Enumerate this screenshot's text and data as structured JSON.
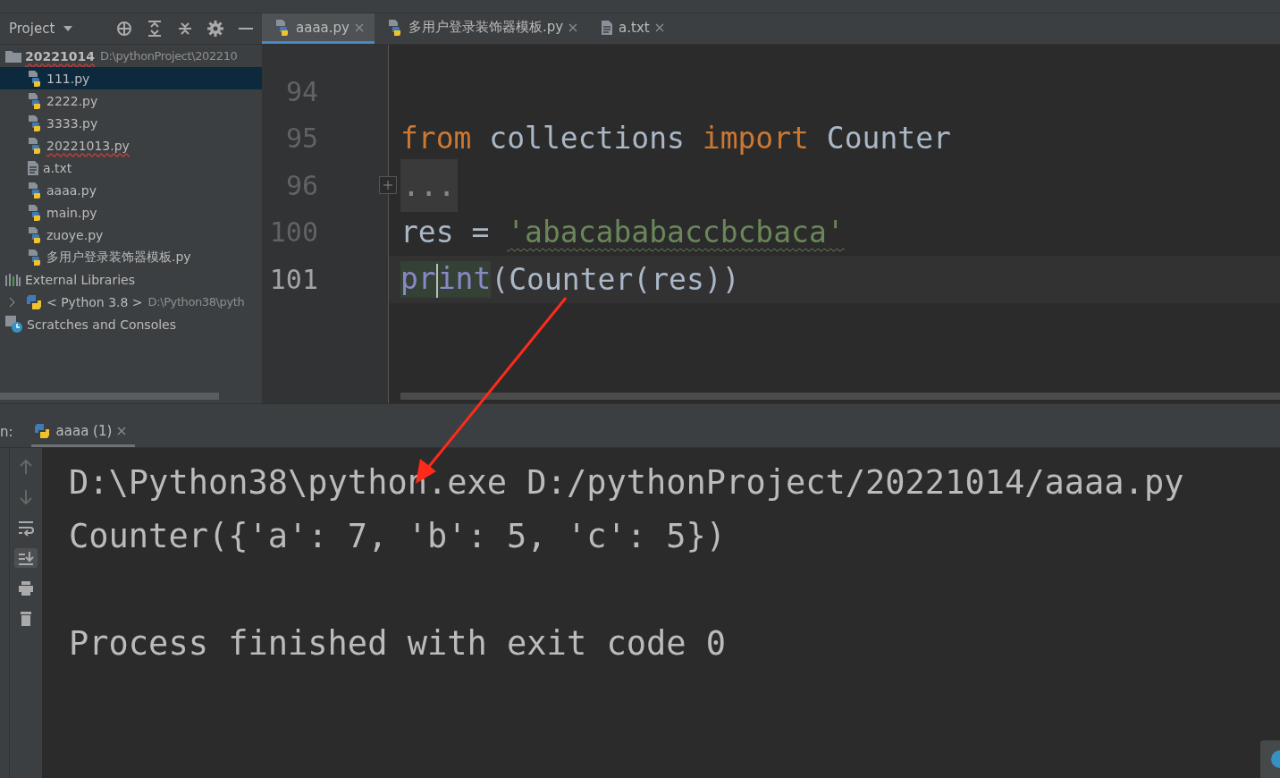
{
  "project_toolbar": {
    "title": "Project"
  },
  "tree": [
    {
      "kind": "folder",
      "label": "20221014",
      "path": "D:\\pythonProject\\202210",
      "error_underline": true,
      "expanded": true,
      "selected": false,
      "children": [
        {
          "kind": "python",
          "label": "111.py",
          "selected": true,
          "error_underline": false
        },
        {
          "kind": "python",
          "label": "2222.py",
          "selected": false,
          "error_underline": false
        },
        {
          "kind": "python",
          "label": "3333.py",
          "selected": false,
          "error_underline": false
        },
        {
          "kind": "python",
          "label": "20221013.py",
          "selected": false,
          "error_underline": true
        },
        {
          "kind": "text",
          "label": "a.txt",
          "selected": false,
          "error_underline": false
        },
        {
          "kind": "python",
          "label": "aaaa.py",
          "selected": false,
          "error_underline": false
        },
        {
          "kind": "python",
          "label": "main.py",
          "selected": false,
          "error_underline": false
        },
        {
          "kind": "python",
          "label": "zuoye.py",
          "selected": false,
          "error_underline": false
        },
        {
          "kind": "python",
          "label": "多用户登录装饰器模板.py",
          "selected": false,
          "error_underline": false
        }
      ]
    },
    {
      "kind": "libraries",
      "label": "External Libraries",
      "selected": false,
      "expanded": true,
      "children": [
        {
          "kind": "sdk",
          "label": "< Python 3.8 >",
          "path": "D:\\Python38\\pyth",
          "selected": false,
          "expanded": false
        }
      ]
    },
    {
      "kind": "scratches",
      "label": "Scratches and Consoles",
      "selected": false
    }
  ],
  "editor_tabs": [
    {
      "kind": "python",
      "label": "aaaa.py",
      "selected": true
    },
    {
      "kind": "python",
      "label": "多用户登录装饰器模板.py",
      "selected": false
    },
    {
      "kind": "text",
      "label": "a.txt",
      "selected": false
    }
  ],
  "code_lines": [
    {
      "number": "94",
      "current": false
    },
    {
      "number": "95",
      "current": false,
      "tokens": [
        {
          "kind": "keyword",
          "text": "from"
        },
        {
          "kind": "plain",
          "text": " collections "
        },
        {
          "kind": "keyword",
          "text": "import"
        },
        {
          "kind": "plain",
          "text": " Counter"
        }
      ]
    },
    {
      "number": "96",
      "current": false,
      "folded": true,
      "tokens": [
        {
          "kind": "fold",
          "text": "..."
        }
      ]
    },
    {
      "number": "100",
      "current": false,
      "tokens": [
        {
          "kind": "plain",
          "text": "res = "
        },
        {
          "kind": "string",
          "text": "'abacababaccbcbaca'"
        }
      ]
    },
    {
      "number": "101",
      "current": true,
      "tokens": [
        {
          "kind": "builtin",
          "text": "print"
        },
        {
          "kind": "plain",
          "text": "(Counter(res))"
        }
      ]
    }
  ],
  "run_panel": {
    "label": "n:",
    "tab": "aaaa (1)",
    "output": [
      {
        "kind": "line",
        "text": "D:\\Python38\\python.exe D:/pythonProject/20221014/aaaa.py"
      },
      {
        "kind": "line",
        "text": "Counter({'a': 7, 'b': 5, 'c': 5})"
      },
      {
        "kind": "exit",
        "text": "Process finished with exit code 0"
      }
    ]
  }
}
